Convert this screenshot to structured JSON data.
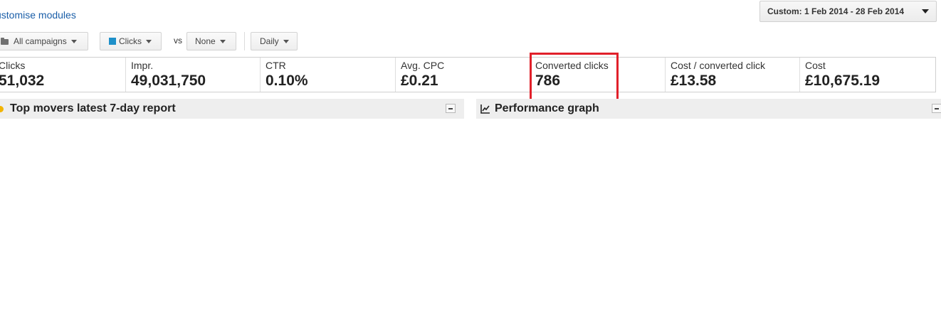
{
  "header": {
    "customise_link": "ustomise modules",
    "date_range_label": "Custom: 1 Feb 2014 - 28 Feb 2014"
  },
  "toolbar": {
    "campaign_filter": "All campaigns",
    "metric1": "Clicks",
    "vs": "vs",
    "metric2": "None",
    "granularity": "Daily",
    "metric1_color": "#1e90c9"
  },
  "metrics": [
    {
      "label": "Clicks",
      "value": "51,032"
    },
    {
      "label": "Impr.",
      "value": "49,031,750"
    },
    {
      "label": "CTR",
      "value": "0.10%"
    },
    {
      "label": "Avg. CPC",
      "value": "£0.21"
    },
    {
      "label": "Converted clicks",
      "value": "786"
    },
    {
      "label": "Cost / converted click",
      "value": "£13.58"
    },
    {
      "label": "Cost",
      "value": "£10,675.19"
    }
  ],
  "highlight_color": "#e1202a",
  "modules": {
    "top_movers_title": "Top movers latest 7-day report",
    "performance_title": "Performance graph"
  }
}
